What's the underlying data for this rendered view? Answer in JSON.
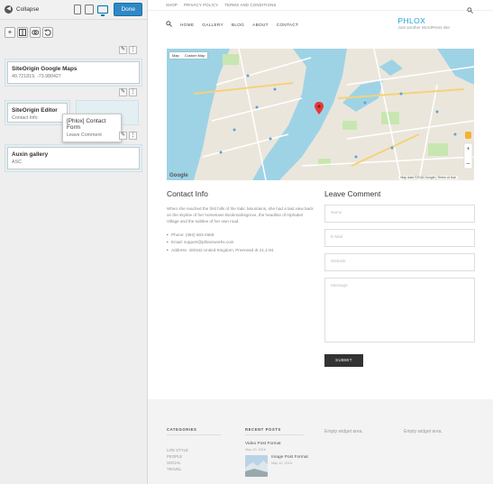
{
  "builder": {
    "collapse_label": "Collapse",
    "done_label": "Done",
    "rows": [
      {
        "title": "SiteOrigin Google Maps",
        "desc": "40.721819, -73.980427"
      },
      {
        "title": "SiteOrigin Editor",
        "desc": "Contact Info",
        "drag_title": "[Phlox] Contact Form",
        "drag_desc": "Leave Comment"
      },
      {
        "title": "Auxin gallery",
        "desc": "ASC"
      }
    ]
  },
  "preview": {
    "topnav": [
      "SHOP",
      "PRIVACY POLICY",
      "TERMS AND CONDITIONS"
    ],
    "menu": [
      "HOME",
      "GALLERY",
      "BLOG",
      "ABOUT",
      "CONTACT"
    ],
    "brand": {
      "name": "PHLOX",
      "tagline": "Just another WordPress site"
    },
    "map": {
      "tabs": [
        "Map",
        "Custom Map"
      ],
      "logo": "Google",
      "credit": "Map data ©2016 Google  |  Terms of Use"
    },
    "contact": {
      "heading": "Contact Info",
      "paragraph": "When she reached the first hills of the Italic Mountains, she had a last view back on the skyline of her hometown Bookmarksgrove, the headline of Alphabet Village and the subline of her own road.",
      "items": [
        "Phone: (392) 583-2569",
        "Email: support@phlanxworks.com",
        "Address: 400342 United Kingdom, Preenead dr 21,1-94"
      ]
    },
    "leave": {
      "heading": "Leave Comment",
      "name_placeholder": "Name",
      "email_placeholder": "E-Mail",
      "website_placeholder": "Website",
      "message_placeholder": "Message",
      "submit_label": "SUBMIT"
    },
    "footer": {
      "categories_head": "CATEGORIES",
      "categories": [
        "LIFE STYLE",
        "PEOPLE",
        "SOCIAL",
        "TRAVEL"
      ],
      "recent_head": "RECENT POSTS",
      "posts": [
        {
          "title": "Video Post Format",
          "date": "May 10, 2016"
        },
        {
          "title": "Image Post Format",
          "date": "May 10, 2016"
        }
      ],
      "empty1": "Empty widget area.",
      "empty2": "Empty widget area."
    }
  }
}
